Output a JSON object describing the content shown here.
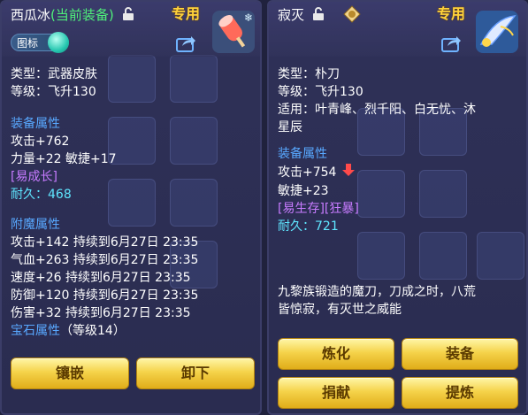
{
  "left": {
    "title": "西瓜冰",
    "equipped": "(当前装备)",
    "exclusive": "专用",
    "icon_toggle_label": "图标",
    "type_line": "类型：武器皮肤",
    "level_line": "等级：飞升130",
    "section_attrs": "装备属性",
    "attack": "攻击+762",
    "str_agi": "力量+22  敏捷+17",
    "tag": "[易成长]",
    "durability_label": "耐久：",
    "durability_value": "468",
    "section_enchant": "附魔属性",
    "enchants": [
      "攻击+142  持续到6月27日  23:35",
      "气血+263  持续到6月27日  23:35",
      "速度+26  持续到6月27日  23:35",
      "防御+120  持续到6月27日  23:35",
      "伤害+32  持续到6月27日  23:35"
    ],
    "gem_label": "宝石属性",
    "gem_level": "（等级14）",
    "btn_inlay": "镶嵌",
    "btn_unequip": "卸下"
  },
  "right": {
    "title": "寂灭",
    "exclusive": "专用",
    "type_line": "类型：朴刀",
    "level_line": "等级：飞升130",
    "suit_line": "适用：叶青峰、烈千阳、白无忧、沐",
    "suit_line2": "星辰",
    "section_attrs": "装备属性",
    "attack": "攻击+754",
    "agility": "敏捷+23",
    "tag": "[易生存][狂暴]",
    "durability_label": "耐久：",
    "durability_value": "721",
    "desc_line1": "九黎族锻造的魔刀，刀成之时，八荒",
    "desc_line2": "皆惊寂，有灭世之威能",
    "btn_refine": "炼化",
    "btn_equip": "装备",
    "btn_donate": "捐献",
    "btn_extract": "提炼"
  },
  "colors": {
    "green": "#4ff07a",
    "gold": "#ffd23a",
    "section": "#58a8ff",
    "purple": "#c77bff",
    "cyan": "#5fe6ff"
  }
}
